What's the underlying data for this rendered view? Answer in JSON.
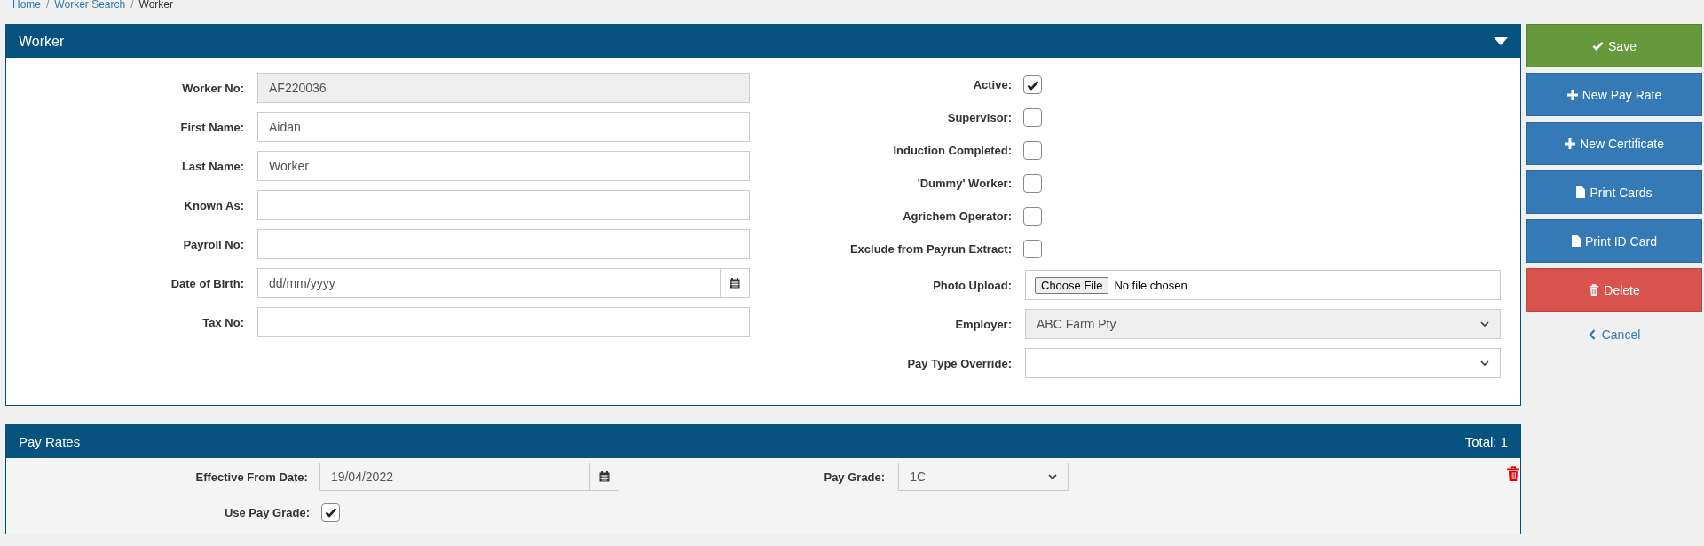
{
  "breadcrumb": [
    {
      "label": "Home",
      "kind": "link",
      "separator": "/"
    },
    {
      "label": "Worker Search",
      "kind": "link",
      "separator": "/"
    },
    {
      "label": "Worker",
      "kind": "current"
    }
  ],
  "worker": {
    "title": "Worker",
    "left_fields": [
      {
        "label": "Worker No:",
        "kind": "text",
        "value": "AF220036",
        "disabled": true
      },
      {
        "label": "First Name:",
        "kind": "text",
        "value": "Aidan",
        "disabled": false
      },
      {
        "label": "Last Name:",
        "kind": "text",
        "value": "Worker",
        "disabled": false
      },
      {
        "label": "Known As:",
        "kind": "text",
        "disabled": false
      },
      {
        "label": "Payroll No:",
        "kind": "text",
        "disabled": false
      },
      {
        "label": "Date of Birth:",
        "kind": "date",
        "placeholder": "dd/mm/yyyy",
        "disabled": false
      },
      {
        "label": "Tax No:",
        "kind": "text",
        "disabled": false
      }
    ],
    "right_fields": [
      {
        "label": "Active:",
        "kind": "checkbox",
        "checked": true
      },
      {
        "label": "Supervisor:",
        "kind": "checkbox",
        "checked": false
      },
      {
        "label": "Induction Completed:",
        "kind": "checkbox",
        "checked": false
      },
      {
        "label": "'Dummy' Worker:",
        "kind": "checkbox",
        "checked": false
      },
      {
        "label": "Agrichem Operator:",
        "kind": "checkbox",
        "checked": false
      },
      {
        "label": "Exclude from Payrun Extract:",
        "kind": "checkbox",
        "checked": false
      },
      {
        "label": "Photo Upload:",
        "kind": "file",
        "button": "Choose File",
        "value": "No file chosen"
      },
      {
        "label": "Employer:",
        "kind": "select",
        "value": "ABC Farm Pty",
        "disabled": true
      },
      {
        "label": "Pay Type Override:",
        "kind": "select",
        "disabled": false
      }
    ]
  },
  "actions": [
    {
      "label": "Save",
      "kind": "save"
    },
    {
      "label": "New Pay Rate",
      "kind": "add"
    },
    {
      "label": "New Certificate",
      "kind": "add"
    },
    {
      "label": "Print Cards",
      "kind": "print"
    },
    {
      "label": "Print ID Card",
      "kind": "print"
    },
    {
      "label": "Delete",
      "kind": "delete"
    },
    {
      "label": "Cancel",
      "kind": "cancel"
    }
  ],
  "pay_rates": {
    "title": "Pay Rates",
    "total": "Total: 1",
    "effective_from": {
      "label": "Effective From Date:",
      "value": "19/04/2022"
    },
    "pay_grade": {
      "label": "Pay Grade:",
      "value": "1C"
    },
    "use_pay_grade": {
      "label": "Use Pay Grade:",
      "checked": true
    }
  }
}
